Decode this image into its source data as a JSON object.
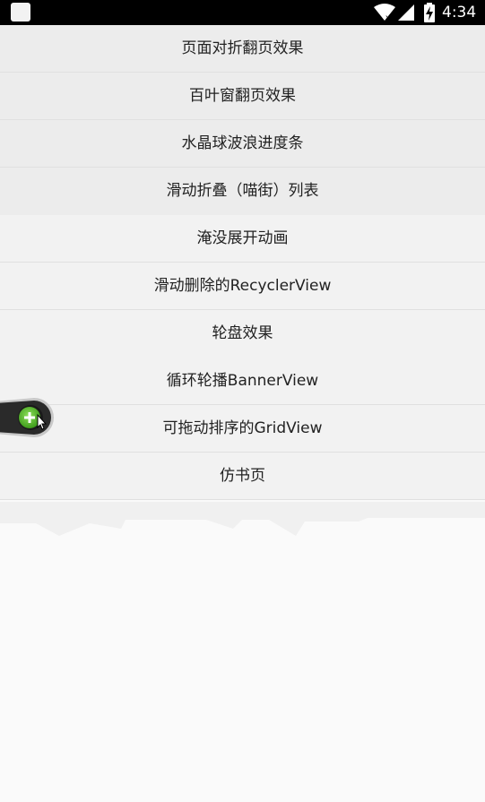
{
  "status_bar": {
    "time": "4:34",
    "icons": [
      "app-icon",
      "wifi-icon",
      "signal-icon",
      "battery-charging-icon"
    ]
  },
  "list": {
    "items": [
      {
        "label": "页面对折翻页效果"
      },
      {
        "label": "百叶窗翻页效果"
      },
      {
        "label": "水晶球波浪进度条"
      },
      {
        "label": "滑动折叠（喵街）列表"
      },
      {
        "label": "淹没展开动画"
      },
      {
        "label": "滑动删除的RecyclerView"
      },
      {
        "label": "轮盘效果"
      },
      {
        "label": "循环轮播BannerView"
      },
      {
        "label": "可拖动排序的GridView"
      },
      {
        "label": "仿书页"
      }
    ]
  },
  "floating_button": {
    "icon": "plus-icon",
    "color": "#5cbf2a"
  }
}
